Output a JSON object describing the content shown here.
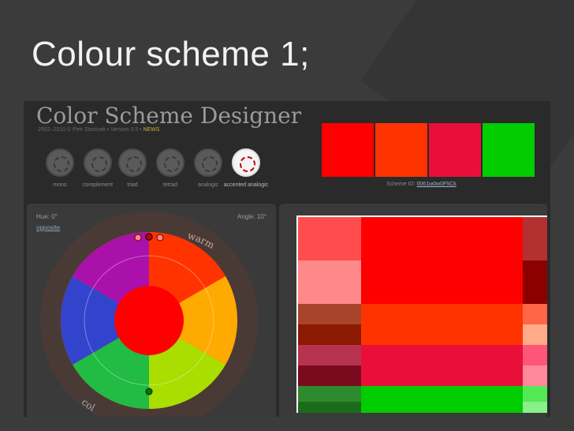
{
  "slide": {
    "title": "Colour scheme 1;"
  },
  "app": {
    "title": "Color Scheme Designer",
    "credit": {
      "prefix": "2002–2010 © ",
      "author": "Petr Stanicek",
      "version": "Version 3.5",
      "news": "NEWS",
      "sep": " • "
    },
    "modes": [
      {
        "label": "mono",
        "active": false,
        "icon": "mono-mode-icon"
      },
      {
        "label": "complement",
        "active": false,
        "icon": "complement-mode-icon"
      },
      {
        "label": "triad",
        "active": false,
        "icon": "triad-mode-icon"
      },
      {
        "label": "tetrad",
        "active": false,
        "icon": "tetrad-mode-icon"
      },
      {
        "label": "analogic",
        "active": false,
        "icon": "analogic-mode-icon"
      },
      {
        "label": "accented analogic",
        "active": true,
        "icon": "accented-analogic-mode-icon"
      }
    ],
    "swatches": [
      "#ff0000",
      "#ff3300",
      "#e8103a",
      "#00cc00"
    ],
    "scheme_id": {
      "label": "Scheme ID: ",
      "value": "0061w0w0F5Ck"
    },
    "wheel": {
      "hue_label": "Hue: 0°",
      "opposite_label": "opposite",
      "angle_label": "Angle: 10°",
      "warm_label": "warm",
      "cold_label": "col",
      "center_color": "#ff0000"
    },
    "palette_grid": {
      "left_column": [
        "#ff4d4d",
        "#ff8888",
        "#a8442a",
        "#8b1a00",
        "#b8334f",
        "#7a0a1e",
        "#2e8a2e",
        "#1a6b1a"
      ],
      "main_blocks": [
        "#ff0000",
        "#ff3300",
        "#e8103a",
        "#00cc00"
      ],
      "right_column": [
        "#b23030",
        "#8c0000",
        "#ff6644",
        "#ffaa88",
        "#ff5577",
        "#ff8899",
        "#55e855",
        "#88f088"
      ]
    }
  },
  "colors": {
    "background": "#3b3b3b",
    "title_text": "#f2f2f2",
    "accent_red": "#ff0000",
    "accent_green": "#00cc00"
  }
}
